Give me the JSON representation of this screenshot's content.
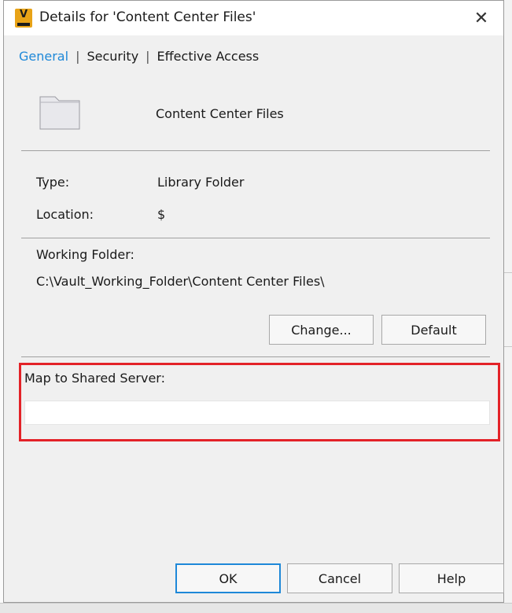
{
  "window": {
    "title": "Details for 'Content Center Files'",
    "app_icon_letter": "V",
    "close_glyph": "✕"
  },
  "tabs": [
    {
      "label": "General",
      "active": true
    },
    {
      "label": "Security",
      "active": false
    },
    {
      "label": "Effective Access",
      "active": false
    }
  ],
  "tab_separator": "|",
  "folder": {
    "name": "Content Center Files",
    "icon": "folder-icon"
  },
  "properties": {
    "type_label": "Type:",
    "type_value": "Library Folder",
    "location_label": "Location:",
    "location_value": "$"
  },
  "working_folder": {
    "label": "Working Folder:",
    "path": "C:\\Vault_Working_Folder\\Content Center Files\\",
    "change_label": "Change...",
    "default_label": "Default"
  },
  "shared_server": {
    "label": "Map to Shared Server:",
    "value": "",
    "highlight_color": "#e32228"
  },
  "footer": {
    "ok_label": "OK",
    "cancel_label": "Cancel",
    "help_label": "Help"
  },
  "colors": {
    "accent": "#1e88d8",
    "dialog_bg": "#f0f0f0",
    "app_icon": "#e8a317"
  }
}
